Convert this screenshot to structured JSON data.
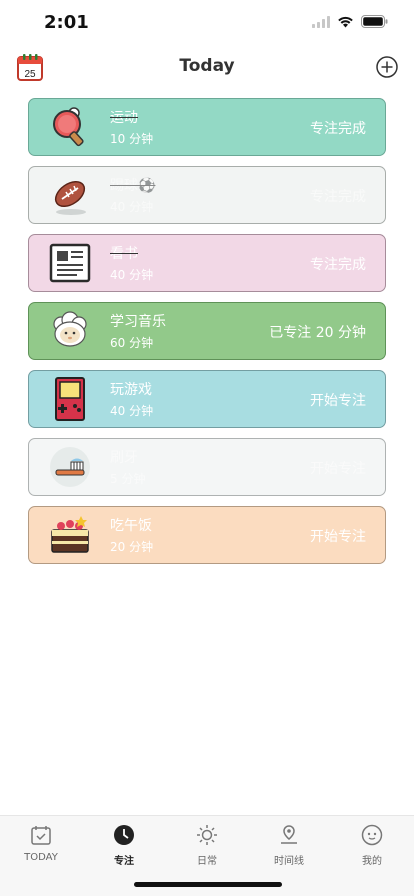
{
  "status_bar": {
    "time": "2:01"
  },
  "nav": {
    "title": "Today",
    "calendar_day": "25"
  },
  "tasks": [
    {
      "name": "运动",
      "duration": "10 分钟",
      "action": "专注完成",
      "bg": "#93d9c5",
      "border": "#6aa896"
    },
    {
      "name": "踢球⚽",
      "duration": "40 分钟",
      "action": "专注完成",
      "bg": "#f2f4f3",
      "border": "#a8adaa"
    },
    {
      "name": "看书",
      "duration": "40 分钟",
      "action": "专注完成",
      "bg": "#f2d8e6",
      "border": "#a68c9a"
    },
    {
      "name": "学习音乐",
      "duration": "60 分钟",
      "action": "已专注 20 分钟",
      "bg": "#92c98a",
      "border": "#5f9258"
    },
    {
      "name": "玩游戏",
      "duration": "40 分钟",
      "action": "开始专注",
      "bg": "#a8dde1",
      "border": "#739ea2"
    },
    {
      "name": "刷牙",
      "duration": "5 分钟",
      "action": "开始专注",
      "bg": "#f4f6f6",
      "border": "#aeb2b2"
    },
    {
      "name": "吃午饭",
      "duration": "20 分钟",
      "action": "开始专注",
      "bg": "#fbdcc0",
      "border": "#b39a82"
    }
  ],
  "tabs": [
    {
      "label": "TODAY",
      "icon": "calendar-check-icon"
    },
    {
      "label": "专注",
      "icon": "clock-icon"
    },
    {
      "label": "日常",
      "icon": "sun-icon"
    },
    {
      "label": "时间线",
      "icon": "map-pin-icon"
    },
    {
      "label": "我的",
      "icon": "face-icon"
    }
  ]
}
